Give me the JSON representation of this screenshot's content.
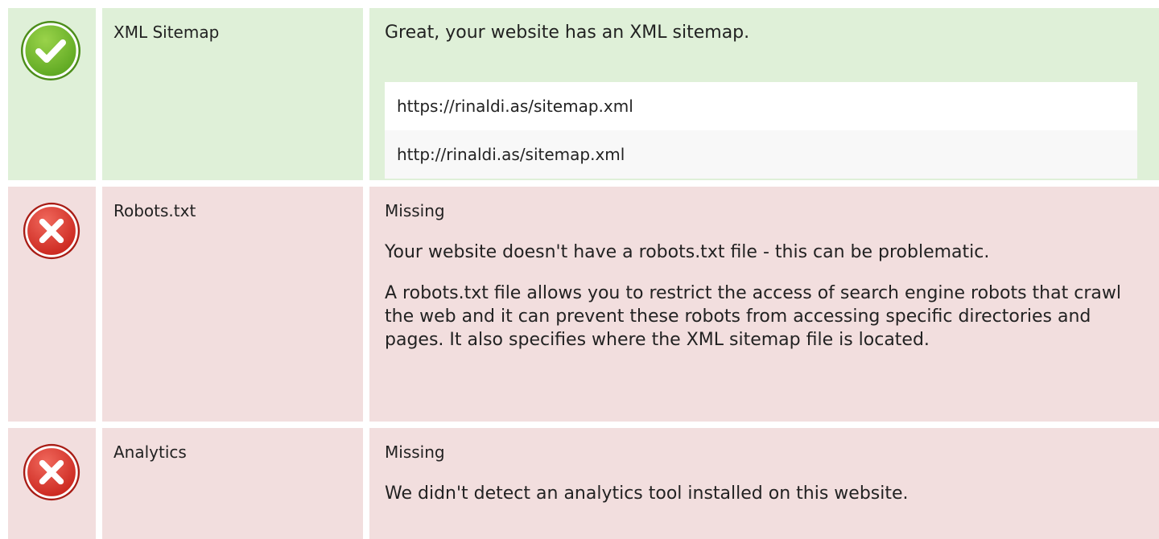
{
  "colors": {
    "pass_bg": "#dff0d8",
    "fail_bg": "#f2dede",
    "pass_icon": "#6dbb2a",
    "fail_icon": "#d9342b"
  },
  "rows": [
    {
      "status": "pass",
      "icon": "check-circle-icon",
      "name": "XML Sitemap",
      "summary": "Great, your website has an XML sitemap.",
      "urls": [
        "https://rinaldi.as/sitemap.xml",
        "http://rinaldi.as/sitemap.xml"
      ]
    },
    {
      "status": "fail",
      "icon": "error-circle-icon",
      "name": "Robots.txt",
      "summary": "Missing",
      "paragraphs": [
        "Your website doesn't have a robots.txt file - this can be problematic.",
        "A robots.txt file allows you to restrict the access of search engine robots that crawl the web and it can prevent these robots from accessing specific directories and pages. It also specifies where the XML sitemap file is located."
      ]
    },
    {
      "status": "fail",
      "icon": "error-circle-icon",
      "name": "Analytics",
      "summary": "Missing",
      "paragraphs": [
        "We didn't detect an analytics tool installed on this website."
      ]
    }
  ]
}
